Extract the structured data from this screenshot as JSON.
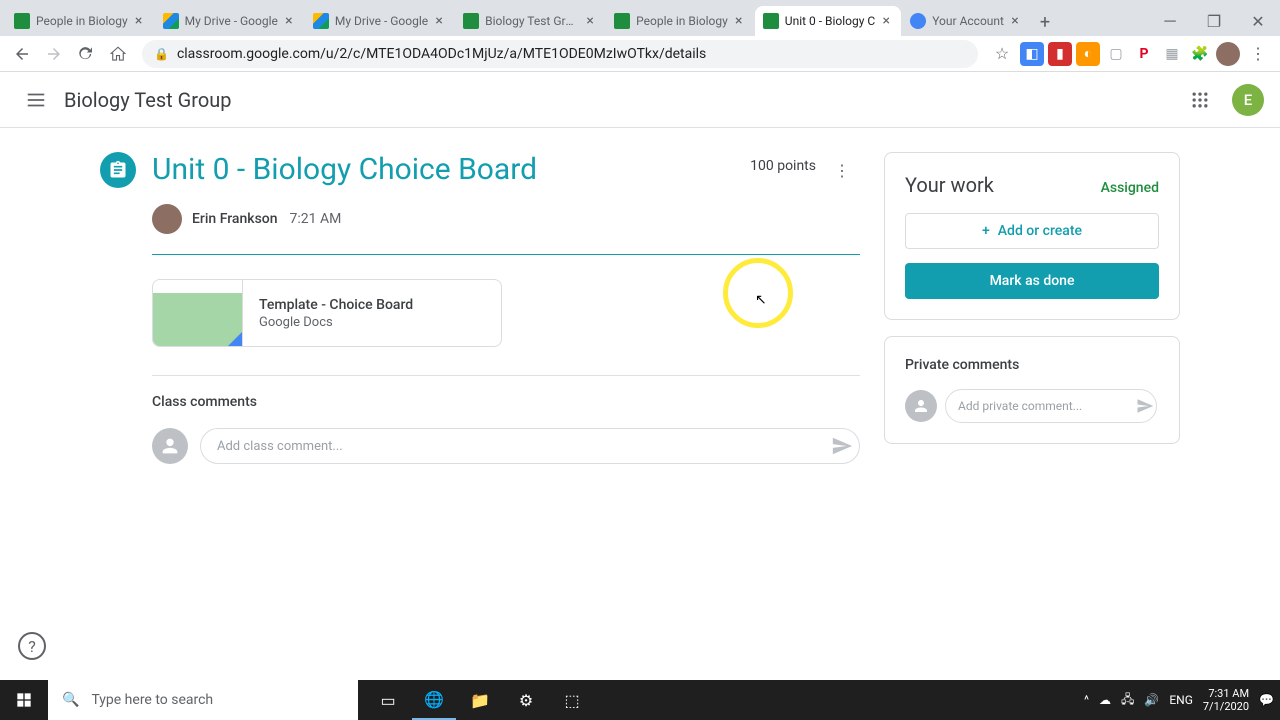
{
  "browser": {
    "tabs": [
      {
        "title": "People in Biology",
        "favicon": "classroom"
      },
      {
        "title": "My Drive - Google",
        "favicon": "drive"
      },
      {
        "title": "My Drive - Google",
        "favicon": "drive"
      },
      {
        "title": "Biology Test Group",
        "favicon": "classroom"
      },
      {
        "title": "People in Biology",
        "favicon": "classroom"
      },
      {
        "title": "Unit 0 - Biology C",
        "favicon": "classroom",
        "active": true
      },
      {
        "title": "Your Account",
        "favicon": "account"
      }
    ],
    "url": "classroom.google.com/u/2/c/MTE1ODA4ODc1MjUz/a/MTE1ODE0MzIwOTkx/details"
  },
  "header": {
    "title": "Biology Test Group",
    "account_initial": "E"
  },
  "assignment": {
    "title": "Unit 0 - Biology Choice Board",
    "points": "100 points",
    "author": "Erin Frankson",
    "time": "7:21 AM",
    "attachment": {
      "title": "Template - Choice Board",
      "type": "Google Docs"
    }
  },
  "comments": {
    "section_title": "Class comments",
    "placeholder": "Add class comment..."
  },
  "work": {
    "title": "Your work",
    "status": "Assigned",
    "add_label": "Add or create",
    "done_label": "Mark as done"
  },
  "private": {
    "title": "Private comments",
    "placeholder": "Add private comment..."
  },
  "taskbar": {
    "search_placeholder": "Type here to search",
    "lang": "ENG",
    "time": "7:31 AM",
    "date": "7/1/2020"
  }
}
